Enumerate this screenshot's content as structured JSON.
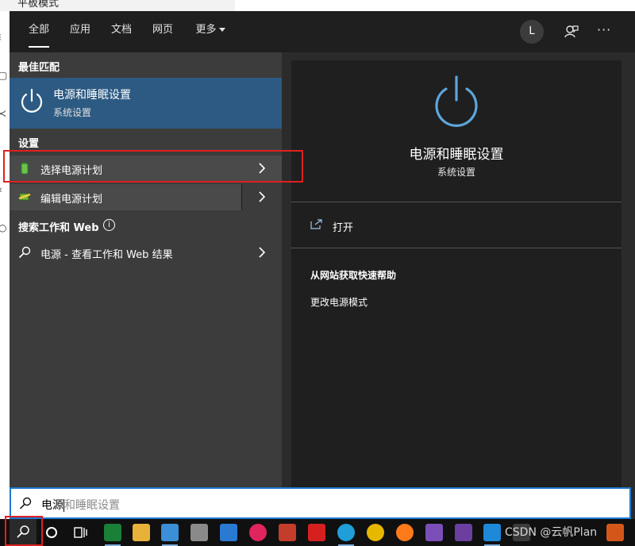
{
  "background_app": {
    "title_fragment": "平板模式"
  },
  "tabs": [
    {
      "label": "全部",
      "active": true
    },
    {
      "label": "应用"
    },
    {
      "label": "文档"
    },
    {
      "label": "网页"
    },
    {
      "label": "更多"
    }
  ],
  "header": {
    "avatar_letter": "L"
  },
  "left": {
    "best_match_heading": "最佳匹配",
    "best_match": {
      "title": "电源和睡眠设置",
      "subtitle": "系统设置"
    },
    "settings_heading": "设置",
    "settings_items": [
      {
        "label": "选择电源计划"
      },
      {
        "label": "编辑电源计划"
      }
    ],
    "web_heading": "搜索工作和 Web",
    "web_item": {
      "label": "电源 - 查看工作和 Web 结果"
    }
  },
  "right": {
    "title": "电源和睡眠设置",
    "subtitle": "系统设置",
    "open_label": "打开",
    "help_heading": "从网站获取快速帮助",
    "help_link": "更改电源模式"
  },
  "search": {
    "typed": "电源",
    "suggestion": "和睡眠设置"
  },
  "watermark": "CSDN @云帆Plan",
  "colors": {
    "accent": "#2c5a82",
    "panel_left": "#3c3c3c",
    "panel_right": "#1f1f1f",
    "highlight": "#e02020",
    "search_border": "#1f78d0"
  }
}
